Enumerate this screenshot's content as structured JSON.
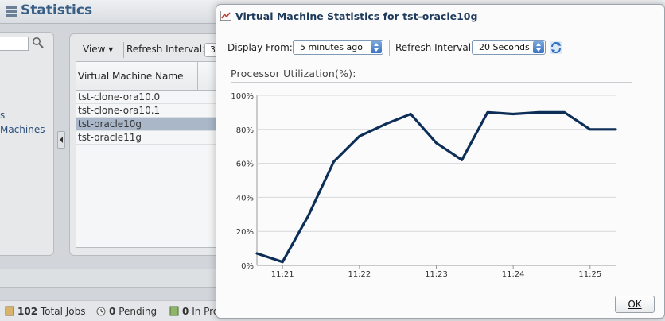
{
  "background": {
    "header": {
      "title": "Statistics"
    },
    "left_panel": {
      "links": [
        "s",
        "Machines"
      ]
    },
    "toolbar": {
      "view_label": "View",
      "refresh_label": "Refresh Interval:",
      "refresh_value": "3"
    },
    "grid": {
      "column_header": "Virtual Machine Name",
      "rows": [
        "tst-clone-ora10.0",
        "tst-clone-ora10.1",
        "tst-oracle10g",
        "tst-oracle11g"
      ],
      "selected_index": 2
    },
    "footer": {
      "total_jobs_count": "102",
      "total_jobs_label": "Total Jobs",
      "pending_count": "0",
      "pending_label": "Pending",
      "inprogress_count": "0",
      "inprogress_label": "In Pro"
    }
  },
  "dialog": {
    "title": "Virtual Machine Statistics for tst-oracle10g",
    "display_from_label": "Display From:",
    "display_from_value": "5 minutes ago",
    "refresh_interval_label": "Refresh Interval:",
    "refresh_interval_value": "20 Seconds",
    "chart_title": "Processor Utilization(%):",
    "ok_label": "OK"
  },
  "colors": {
    "line": "#0d2f57",
    "title_blue": "#1d3a5c",
    "accent": "#3a73c4"
  },
  "chart_data": {
    "type": "line",
    "title": "Processor Utilization(%):",
    "xlabel": "",
    "ylabel": "",
    "x_tick_labels": [
      "11:21",
      "11:22",
      "11:23",
      "11:24",
      "11:25"
    ],
    "y_tick_labels": [
      "0%",
      "20%",
      "40%",
      "60%",
      "80%",
      "100%"
    ],
    "ylim": [
      0,
      100
    ],
    "grid": "horizontal",
    "series": [
      {
        "x": [
          "11:20:40",
          "11:21:00",
          "11:21:20",
          "11:21:40",
          "11:22:00",
          "11:22:20",
          "11:22:40",
          "11:23:00",
          "11:23:20",
          "11:23:40",
          "11:24:00",
          "11:24:20",
          "11:24:40",
          "11:25:00",
          "11:25:20"
        ],
        "values": [
          7,
          2,
          29,
          61,
          76,
          83,
          89,
          72,
          62,
          90,
          89,
          90,
          90,
          80,
          80
        ]
      }
    ]
  }
}
